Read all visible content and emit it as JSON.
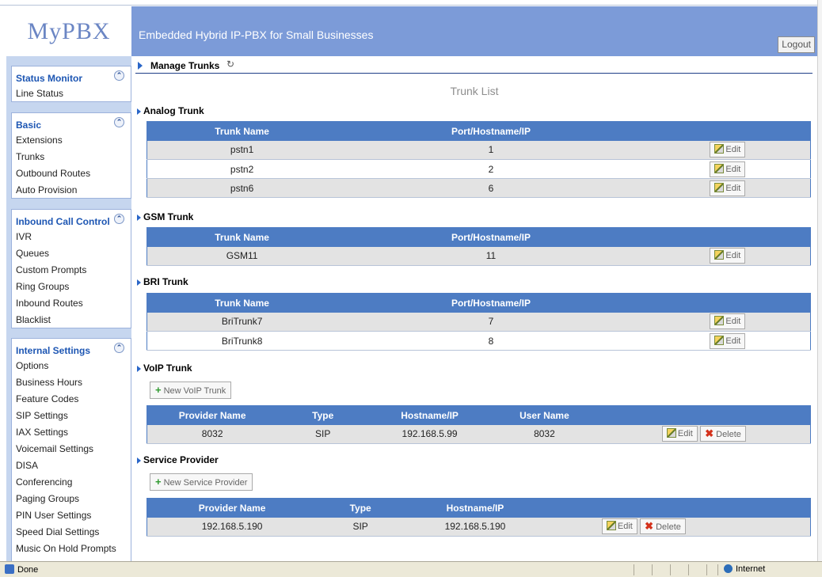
{
  "app": {
    "logo": "MyPBX",
    "header_title": "Embedded Hybrid IP-PBX for Small Businesses",
    "logout": "Logout"
  },
  "sidebar": {
    "groups": [
      {
        "title": "Status Monitor",
        "items": [
          "Line Status"
        ]
      },
      {
        "title": "Basic",
        "items": [
          "Extensions",
          "Trunks",
          "Outbound Routes",
          "Auto Provision"
        ]
      },
      {
        "title": "Inbound Call Control",
        "items": [
          "IVR",
          "Queues",
          "Custom Prompts",
          "Ring Groups",
          "Inbound Routes",
          "Blacklist"
        ]
      },
      {
        "title": "Internal Settings",
        "items": [
          "Options",
          "Business Hours",
          "Feature Codes",
          "SIP Settings",
          "IAX Settings",
          "Voicemail Settings",
          "DISA",
          "Conferencing",
          "Paging Groups",
          "PIN User Settings",
          "Speed Dial Settings",
          "Music On Hold Prompts"
        ]
      }
    ]
  },
  "main": {
    "title": "Manage Trunks",
    "subtitle": "Trunk List",
    "analog": {
      "title": "Analog Trunk",
      "headers": [
        "Trunk Name",
        "Port/Hostname/IP"
      ],
      "rows": [
        {
          "name": "pstn1",
          "port": "1"
        },
        {
          "name": "pstn2",
          "port": "2"
        },
        {
          "name": "pstn6",
          "port": "6"
        }
      ]
    },
    "gsm": {
      "title": "GSM Trunk",
      "headers": [
        "Trunk Name",
        "Port/Hostname/IP"
      ],
      "rows": [
        {
          "name": "GSM11",
          "port": "11"
        }
      ]
    },
    "bri": {
      "title": "BRI Trunk",
      "headers": [
        "Trunk Name",
        "Port/Hostname/IP"
      ],
      "rows": [
        {
          "name": "BriTrunk7",
          "port": "7"
        },
        {
          "name": "BriTrunk8",
          "port": "8"
        }
      ]
    },
    "voip": {
      "title": "VoIP Trunk",
      "new_button": "New VoIP Trunk",
      "headers": [
        "Provider Name",
        "Type",
        "Hostname/IP",
        "User Name"
      ],
      "rows": [
        {
          "provider": "8032",
          "type": "SIP",
          "host": "192.168.5.99",
          "user": "8032"
        }
      ]
    },
    "service": {
      "title": "Service Provider",
      "new_button": "New Service Provider",
      "headers": [
        "Provider Name",
        "Type",
        "Hostname/IP"
      ],
      "rows": [
        {
          "provider": "192.168.5.190",
          "type": "SIP",
          "host": "192.168.5.190"
        }
      ]
    },
    "edit_label": "Edit",
    "delete_label": "Delete"
  },
  "status_bar": {
    "left": "Done",
    "right": "Internet"
  },
  "colors": {
    "header_bg": "#7c9bd8",
    "table_header": "#4d7cc3",
    "sidebar_bg": "#c6d6ef",
    "sidebar_heading": "#1d56b3"
  }
}
